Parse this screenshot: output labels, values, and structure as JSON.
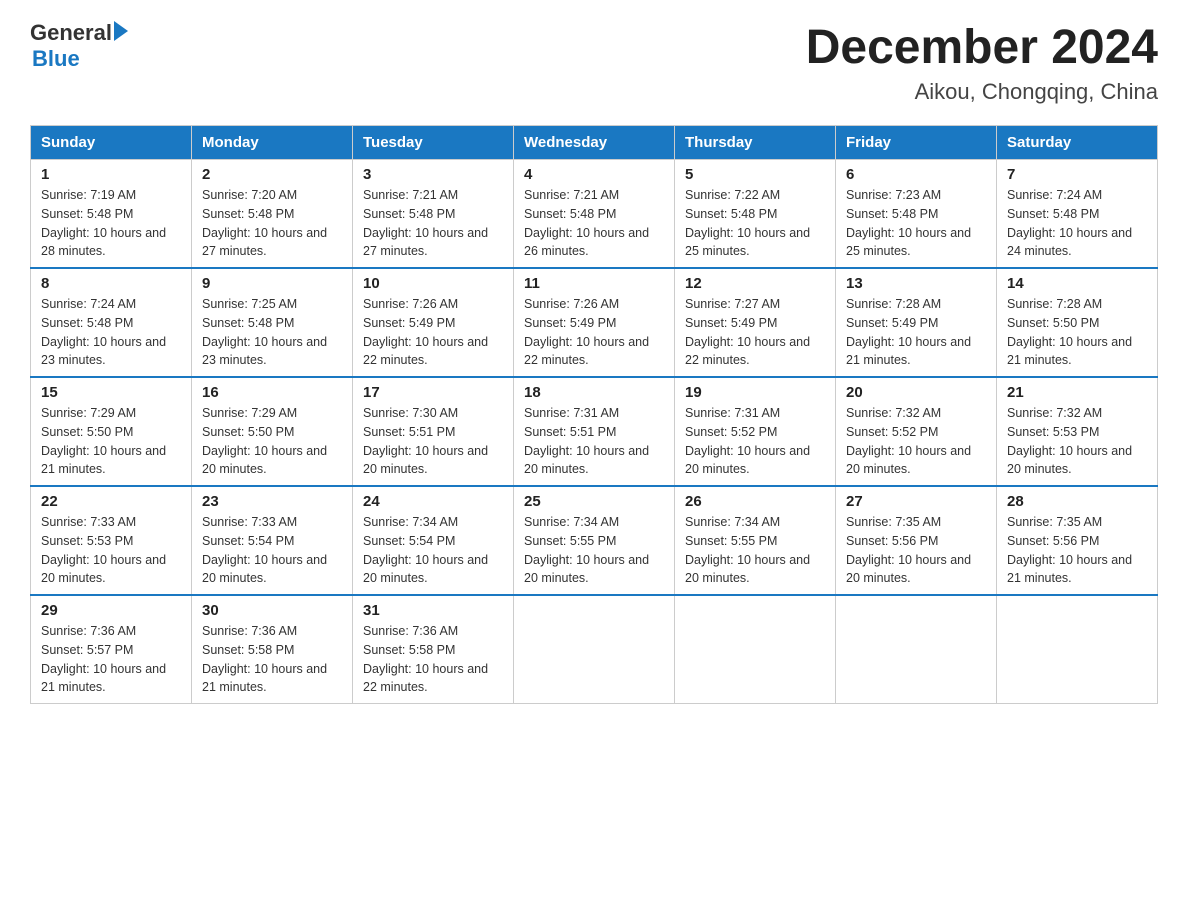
{
  "logo": {
    "general": "General",
    "blue": "Blue"
  },
  "title": {
    "month_year": "December 2024",
    "location": "Aikou, Chongqing, China"
  },
  "headers": [
    "Sunday",
    "Monday",
    "Tuesday",
    "Wednesday",
    "Thursday",
    "Friday",
    "Saturday"
  ],
  "weeks": [
    [
      {
        "day": "1",
        "sunrise": "7:19 AM",
        "sunset": "5:48 PM",
        "daylight": "10 hours and 28 minutes."
      },
      {
        "day": "2",
        "sunrise": "7:20 AM",
        "sunset": "5:48 PM",
        "daylight": "10 hours and 27 minutes."
      },
      {
        "day": "3",
        "sunrise": "7:21 AM",
        "sunset": "5:48 PM",
        "daylight": "10 hours and 27 minutes."
      },
      {
        "day": "4",
        "sunrise": "7:21 AM",
        "sunset": "5:48 PM",
        "daylight": "10 hours and 26 minutes."
      },
      {
        "day": "5",
        "sunrise": "7:22 AM",
        "sunset": "5:48 PM",
        "daylight": "10 hours and 25 minutes."
      },
      {
        "day": "6",
        "sunrise": "7:23 AM",
        "sunset": "5:48 PM",
        "daylight": "10 hours and 25 minutes."
      },
      {
        "day": "7",
        "sunrise": "7:24 AM",
        "sunset": "5:48 PM",
        "daylight": "10 hours and 24 minutes."
      }
    ],
    [
      {
        "day": "8",
        "sunrise": "7:24 AM",
        "sunset": "5:48 PM",
        "daylight": "10 hours and 23 minutes."
      },
      {
        "day": "9",
        "sunrise": "7:25 AM",
        "sunset": "5:48 PM",
        "daylight": "10 hours and 23 minutes."
      },
      {
        "day": "10",
        "sunrise": "7:26 AM",
        "sunset": "5:49 PM",
        "daylight": "10 hours and 22 minutes."
      },
      {
        "day": "11",
        "sunrise": "7:26 AM",
        "sunset": "5:49 PM",
        "daylight": "10 hours and 22 minutes."
      },
      {
        "day": "12",
        "sunrise": "7:27 AM",
        "sunset": "5:49 PM",
        "daylight": "10 hours and 22 minutes."
      },
      {
        "day": "13",
        "sunrise": "7:28 AM",
        "sunset": "5:49 PM",
        "daylight": "10 hours and 21 minutes."
      },
      {
        "day": "14",
        "sunrise": "7:28 AM",
        "sunset": "5:50 PM",
        "daylight": "10 hours and 21 minutes."
      }
    ],
    [
      {
        "day": "15",
        "sunrise": "7:29 AM",
        "sunset": "5:50 PM",
        "daylight": "10 hours and 21 minutes."
      },
      {
        "day": "16",
        "sunrise": "7:29 AM",
        "sunset": "5:50 PM",
        "daylight": "10 hours and 20 minutes."
      },
      {
        "day": "17",
        "sunrise": "7:30 AM",
        "sunset": "5:51 PM",
        "daylight": "10 hours and 20 minutes."
      },
      {
        "day": "18",
        "sunrise": "7:31 AM",
        "sunset": "5:51 PM",
        "daylight": "10 hours and 20 minutes."
      },
      {
        "day": "19",
        "sunrise": "7:31 AM",
        "sunset": "5:52 PM",
        "daylight": "10 hours and 20 minutes."
      },
      {
        "day": "20",
        "sunrise": "7:32 AM",
        "sunset": "5:52 PM",
        "daylight": "10 hours and 20 minutes."
      },
      {
        "day": "21",
        "sunrise": "7:32 AM",
        "sunset": "5:53 PM",
        "daylight": "10 hours and 20 minutes."
      }
    ],
    [
      {
        "day": "22",
        "sunrise": "7:33 AM",
        "sunset": "5:53 PM",
        "daylight": "10 hours and 20 minutes."
      },
      {
        "day": "23",
        "sunrise": "7:33 AM",
        "sunset": "5:54 PM",
        "daylight": "10 hours and 20 minutes."
      },
      {
        "day": "24",
        "sunrise": "7:34 AM",
        "sunset": "5:54 PM",
        "daylight": "10 hours and 20 minutes."
      },
      {
        "day": "25",
        "sunrise": "7:34 AM",
        "sunset": "5:55 PM",
        "daylight": "10 hours and 20 minutes."
      },
      {
        "day": "26",
        "sunrise": "7:34 AM",
        "sunset": "5:55 PM",
        "daylight": "10 hours and 20 minutes."
      },
      {
        "day": "27",
        "sunrise": "7:35 AM",
        "sunset": "5:56 PM",
        "daylight": "10 hours and 20 minutes."
      },
      {
        "day": "28",
        "sunrise": "7:35 AM",
        "sunset": "5:56 PM",
        "daylight": "10 hours and 21 minutes."
      }
    ],
    [
      {
        "day": "29",
        "sunrise": "7:36 AM",
        "sunset": "5:57 PM",
        "daylight": "10 hours and 21 minutes."
      },
      {
        "day": "30",
        "sunrise": "7:36 AM",
        "sunset": "5:58 PM",
        "daylight": "10 hours and 21 minutes."
      },
      {
        "day": "31",
        "sunrise": "7:36 AM",
        "sunset": "5:58 PM",
        "daylight": "10 hours and 22 minutes."
      },
      null,
      null,
      null,
      null
    ]
  ]
}
